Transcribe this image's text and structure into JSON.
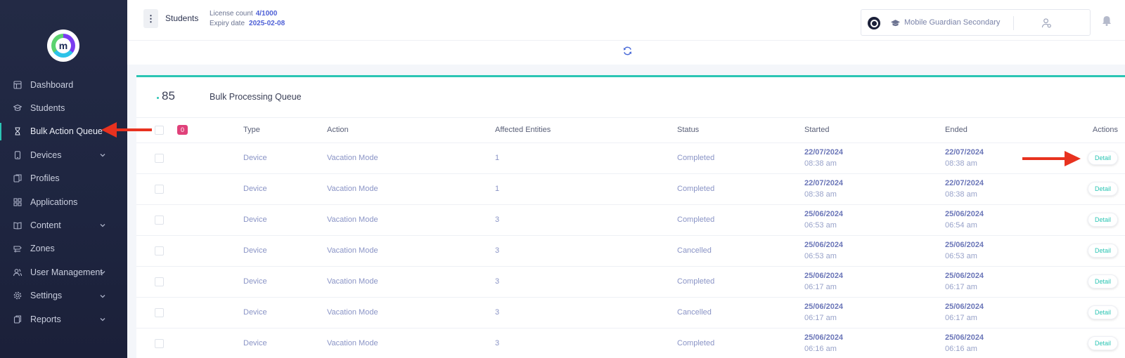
{
  "sidebar": {
    "logo_letter": "m",
    "items": [
      {
        "label": "Dashboard",
        "icon": "dashboard-icon",
        "has_chevron": false,
        "active": false
      },
      {
        "label": "Students",
        "icon": "students-icon",
        "has_chevron": false,
        "active": false
      },
      {
        "label": "Bulk Action Queue",
        "icon": "hourglass-icon",
        "has_chevron": false,
        "active": true
      },
      {
        "label": "Devices",
        "icon": "device-icon",
        "has_chevron": true,
        "active": false
      },
      {
        "label": "Profiles",
        "icon": "profiles-icon",
        "has_chevron": false,
        "active": false
      },
      {
        "label": "Applications",
        "icon": "applications-icon",
        "has_chevron": false,
        "active": false
      },
      {
        "label": "Content",
        "icon": "content-icon",
        "has_chevron": true,
        "active": false
      },
      {
        "label": "Zones",
        "icon": "zones-icon",
        "has_chevron": false,
        "active": false
      },
      {
        "label": "User Management",
        "icon": "user-management-icon",
        "has_chevron": true,
        "active": false
      },
      {
        "label": "Settings",
        "icon": "settings-icon",
        "has_chevron": true,
        "active": false
      },
      {
        "label": "Reports",
        "icon": "reports-icon",
        "has_chevron": true,
        "active": false
      }
    ]
  },
  "header": {
    "menu_icon": "⋮",
    "title": "Students",
    "license_label": "License count",
    "license_value": "4/1000",
    "expiry_label": "Expiry date",
    "expiry_value": "2025-02-08",
    "org_name": "Mobile Guardian Secondary"
  },
  "card": {
    "count": "85",
    "title": "Bulk Processing Queue",
    "selected_badge": "0",
    "columns": [
      "Type",
      "Action",
      "Affected Entities",
      "Status",
      "Started",
      "Ended",
      "Actions"
    ],
    "rows": [
      {
        "type": "Device",
        "action": "Vacation Mode",
        "affected": "1",
        "status": "Completed",
        "started_date": "22/07/2024",
        "started_time": "08:38 am",
        "ended_date": "22/07/2024",
        "ended_time": "08:38 am",
        "action_label": "Detail"
      },
      {
        "type": "Device",
        "action": "Vacation Mode",
        "affected": "1",
        "status": "Completed",
        "started_date": "22/07/2024",
        "started_time": "08:38 am",
        "ended_date": "22/07/2024",
        "ended_time": "08:38 am",
        "action_label": "Detail"
      },
      {
        "type": "Device",
        "action": "Vacation Mode",
        "affected": "3",
        "status": "Completed",
        "started_date": "25/06/2024",
        "started_time": "06:53 am",
        "ended_date": "25/06/2024",
        "ended_time": "06:54 am",
        "action_label": "Detail"
      },
      {
        "type": "Device",
        "action": "Vacation Mode",
        "affected": "3",
        "status": "Cancelled",
        "started_date": "25/06/2024",
        "started_time": "06:53 am",
        "ended_date": "25/06/2024",
        "ended_time": "06:53 am",
        "action_label": "Detail"
      },
      {
        "type": "Device",
        "action": "Vacation Mode",
        "affected": "3",
        "status": "Completed",
        "started_date": "25/06/2024",
        "started_time": "06:17 am",
        "ended_date": "25/06/2024",
        "ended_time": "06:17 am",
        "action_label": "Detail"
      },
      {
        "type": "Device",
        "action": "Vacation Mode",
        "affected": "3",
        "status": "Cancelled",
        "started_date": "25/06/2024",
        "started_time": "06:17 am",
        "ended_date": "25/06/2024",
        "ended_time": "06:17 am",
        "action_label": "Detail"
      },
      {
        "type": "Device",
        "action": "Vacation Mode",
        "affected": "3",
        "status": "Completed",
        "started_date": "25/06/2024",
        "started_time": "06:16 am",
        "ended_date": "25/06/2024",
        "ended_time": "06:16 am",
        "action_label": "Detail"
      }
    ]
  },
  "colors": {
    "sidebar_bg": "#1e2540",
    "accent_teal": "#2bc5b4",
    "badge_pink": "#e0417a",
    "link_blue": "#4d5fd6",
    "annotation_red": "#e8321f"
  }
}
